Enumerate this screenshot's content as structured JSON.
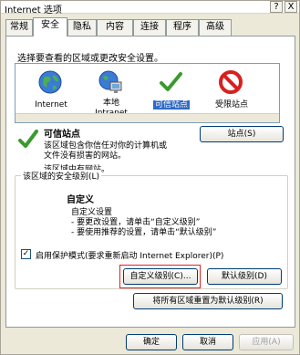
{
  "window": {
    "title": "Internet 选项",
    "help_btn": "?",
    "close_btn": "X"
  },
  "tabs": [
    "常规",
    "安全",
    "隐私",
    "内容",
    "连接",
    "程序",
    "高级"
  ],
  "active_tab": "安全",
  "security": {
    "zone_instruction": "选择要查看的区域或更改安全设置。",
    "zones": [
      {
        "icon": "globe-icon",
        "label": "Internet",
        "label2": ""
      },
      {
        "icon": "intranet-icon",
        "label": "本地",
        "label2": "Intranet"
      },
      {
        "icon": "checkmark-icon",
        "label": "可信站点",
        "label2": ""
      },
      {
        "icon": "restricted-icon",
        "label": "受限站点",
        "label2": ""
      }
    ],
    "selected_zone": "可信站点",
    "zone_title": "可信站点",
    "zone_desc_1": "该区域包含你信任对你的计算机或",
    "zone_desc_2": "文件没有损害的网站。",
    "zone_no_sites": "该区域中有网站。",
    "sites_button": "站点(S)",
    "security_level_label": "该区域的安全级别(L)",
    "level_name": "自定义",
    "level_desc_1": "自定义设置",
    "level_desc_2": "- 要更改设置，请单击“自定义级别”",
    "level_desc_3": "- 要使用推荐的设置，请单击“默认级别”",
    "protected_mode_checked": true,
    "protected_mode_check_glyph": "✓",
    "protected_mode_label": "启用保护模式(要求重新启动 Internet Explorer)(P)",
    "custom_level_button": "自定义级别(C)...",
    "default_level_button": "默认级别(D)",
    "reset_all_button": "将所有区域重置为默认级别(R)"
  },
  "footer": {
    "ok_button": "确定",
    "cancel_button": "取消",
    "apply_button": "应用(A)"
  },
  "colors": {
    "selection": "#316ac5",
    "highlight_box": "#e02020",
    "check_green": "#3a9a2e",
    "restricted_red": "#d82020"
  }
}
